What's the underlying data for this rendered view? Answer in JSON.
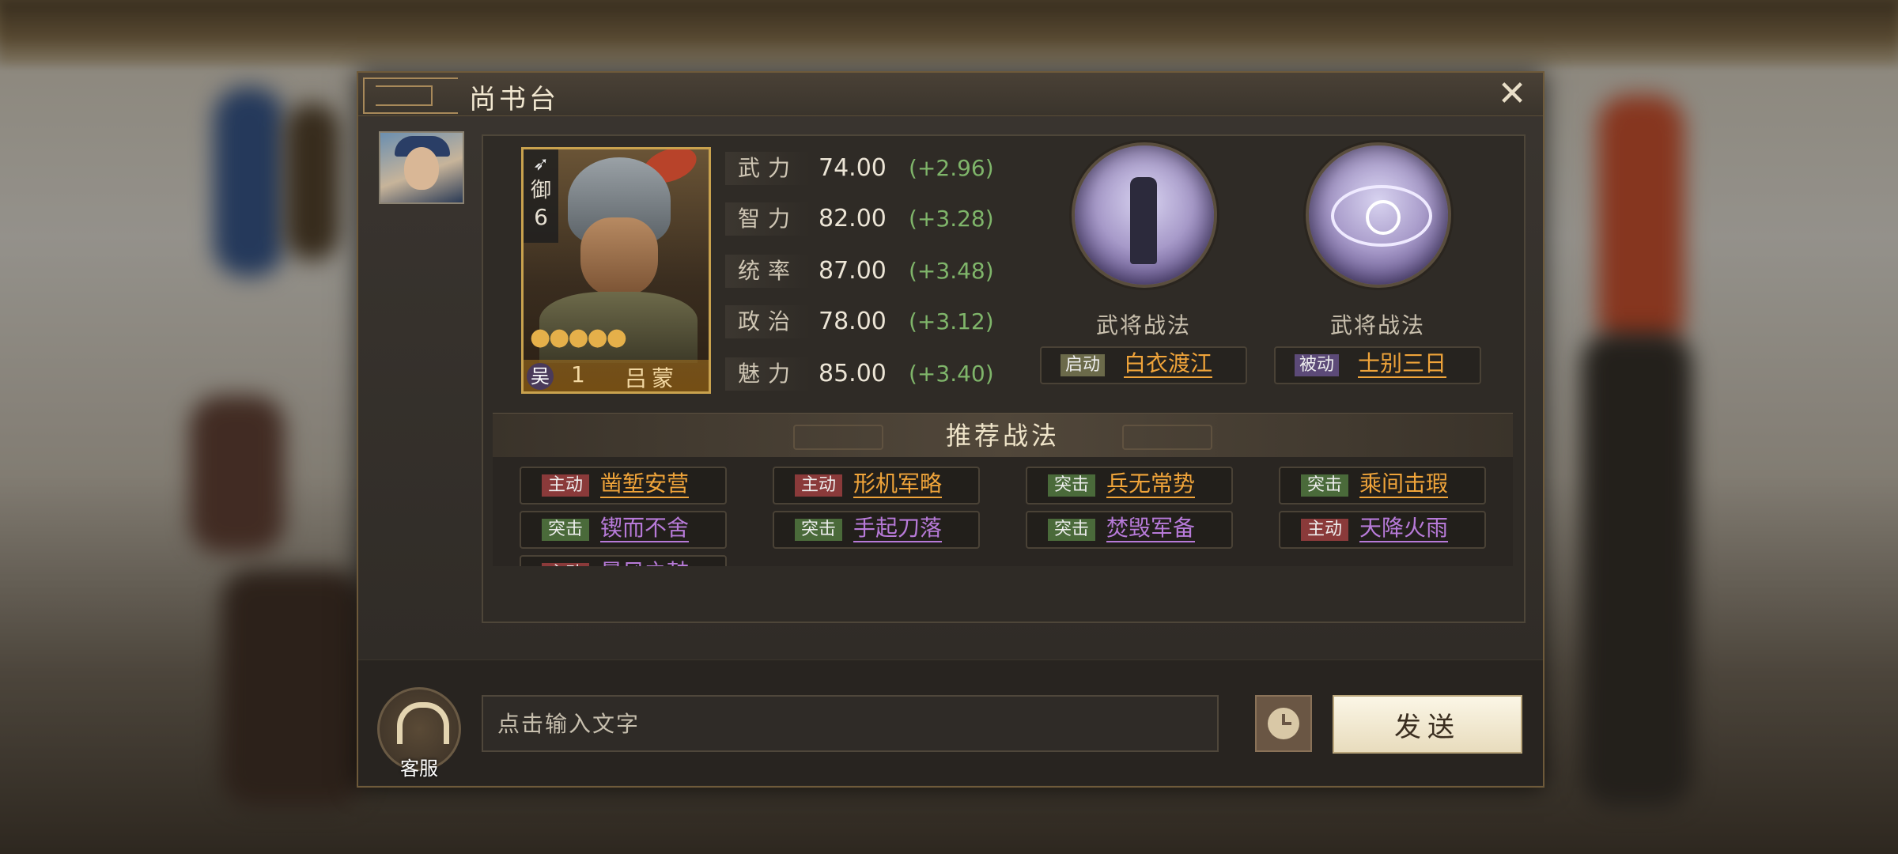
{
  "dialog": {
    "title": "尚书台",
    "close": "✕"
  },
  "card": {
    "unit_type": "御",
    "unit_level": "6",
    "stars": "●●●●●",
    "faction": "吴",
    "rank": "1",
    "name": "吕蒙"
  },
  "stats": [
    {
      "label": "武力",
      "value": "74.00",
      "bonus": "(+2.96)"
    },
    {
      "label": "智力",
      "value": "82.00",
      "bonus": "(+3.28)"
    },
    {
      "label": "统率",
      "value": "87.00",
      "bonus": "(+3.48)"
    },
    {
      "label": "政治",
      "value": "78.00",
      "bonus": "(+3.12)"
    },
    {
      "label": "魅力",
      "value": "85.00",
      "bonus": "(+3.40)"
    }
  ],
  "skills": [
    {
      "kind": "武将战法",
      "tag": "启动",
      "name": "白衣渡江",
      "tag_color": "#6b6a4a"
    },
    {
      "kind": "武将战法",
      "tag": "被动",
      "name": "士别三日",
      "tag_color": "#5c4a78"
    }
  ],
  "recommended": {
    "title": "推荐战法",
    "items": [
      {
        "tag": "主动",
        "name": "凿堑安营",
        "tag_color": "#8a3a3a",
        "name_color": "#f0a43a"
      },
      {
        "tag": "主动",
        "name": "形机军略",
        "tag_color": "#8a3a3a",
        "name_color": "#f0a43a"
      },
      {
        "tag": "突击",
        "name": "兵无常势",
        "tag_color": "#4a6a3a",
        "name_color": "#f0a43a"
      },
      {
        "tag": "突击",
        "name": "乘间击瑕",
        "tag_color": "#4a6a3a",
        "name_color": "#f0a43a"
      },
      {
        "tag": "突击",
        "name": "锲而不舍",
        "tag_color": "#4a6a3a",
        "name_color": "#b77ad8"
      },
      {
        "tag": "突击",
        "name": "手起刀落",
        "tag_color": "#4a6a3a",
        "name_color": "#b77ad8"
      },
      {
        "tag": "突击",
        "name": "焚毁军备",
        "tag_color": "#4a6a3a",
        "name_color": "#b77ad8"
      },
      {
        "tag": "主动",
        "name": "天降火雨",
        "tag_color": "#8a3a3a",
        "name_color": "#b77ad8"
      },
      {
        "tag": "主动",
        "name": "暴风之鼓",
        "tag_color": "#8a3a3a",
        "name_color": "#b77ad8"
      }
    ]
  },
  "bottom": {
    "service_label": "客服",
    "input_placeholder": "点击输入文字",
    "send_label": "发送"
  }
}
